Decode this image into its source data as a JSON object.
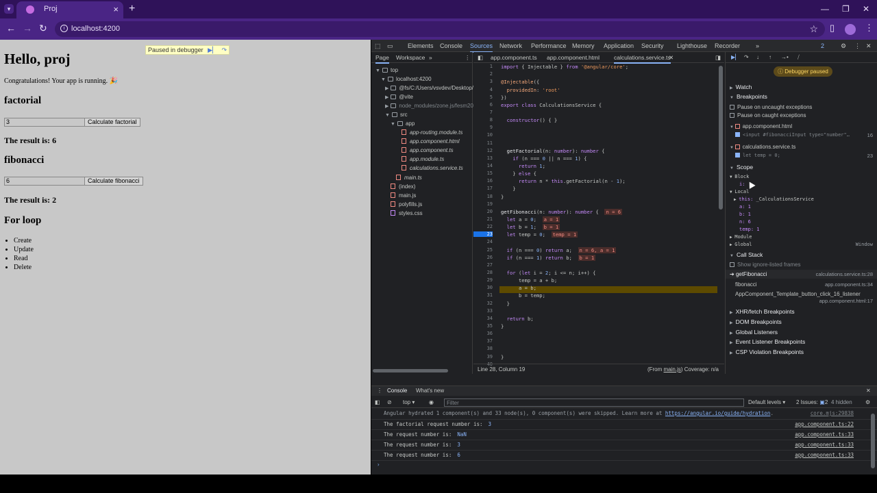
{
  "browser": {
    "tab_title": "Proj",
    "url": "localhost:4200"
  },
  "page": {
    "paused_label": "Paused in debugger",
    "h1": "Hello, proj",
    "congrats": "Congratulations! Your app is running. 🎉",
    "factorial": {
      "heading": "factorial",
      "input_value": "3",
      "button": "Calculate factorial",
      "result": "The result is: 6"
    },
    "fibonacci": {
      "heading": "fibonacci",
      "input_value": "6",
      "button": "Calculate fibonacci",
      "result": "The result is: 2"
    },
    "loop": {
      "heading": "For loop",
      "items": [
        "Create",
        "Update",
        "Read",
        "Delete"
      ]
    }
  },
  "devtools": {
    "tabs": [
      "Elements",
      "Console",
      "Sources",
      "Network",
      "Performance",
      "Memory",
      "Application",
      "Security",
      "Lighthouse",
      "Recorder"
    ],
    "active_tab": "Sources",
    "issues_badge": "2",
    "nav_subtabs": [
      "Page",
      "Workspace"
    ],
    "tree": [
      "top",
      "localhost:4200",
      "@fs/C:/Users/vsvdev/Desktop/",
      "@vite",
      "node_modules/zone.js/fesm20",
      "src",
      "app",
      "app-routing.module.ts",
      "app.component.html",
      "app.component.ts",
      "app.module.ts",
      "calculations.service.ts",
      "main.ts",
      "(index)",
      "main.js",
      "polyfills.js",
      "styles.css"
    ],
    "editor_tabs": [
      "app.component.ts",
      "app.component.html",
      "calculations.service.ts"
    ],
    "status_left": "Line 28, Column 19",
    "status_from": "(From ",
    "status_link": "main.js",
    "status_cov": ") Coverage: n/a",
    "debugger_paused": "Debugger paused",
    "sections": {
      "watch": "Watch",
      "breakpoints": "Breakpoints",
      "pause_uncaught": "Pause on uncaught exceptions",
      "pause_caught": "Pause on caught exceptions",
      "bp_file1": "app.component.html",
      "bp_code1": "<input #fibonacciInput type=\"number\"…",
      "bp_line1": "16",
      "bp_file2": "calculations.service.ts",
      "bp_code2": "let temp = 0;",
      "bp_line2": "23",
      "scope": "Scope",
      "block": "Block",
      "block_i": "i:",
      "local": "Local",
      "this_label": "this:",
      "this_val": "_CalculationsService",
      "local_vars": [
        "a: 1",
        "b: 1",
        "n: 6",
        "temp: 1"
      ],
      "module": "Module",
      "global": "Global",
      "global_val": "Window",
      "call_stack": "Call Stack",
      "show_ignore": "Show ignore-listed frames",
      "frames": [
        {
          "name": "getFibonacci",
          "loc": "calculations.service.ts:28"
        },
        {
          "name": "fibonacci",
          "loc": "app.component.ts:34"
        },
        {
          "name": "AppComponent_Template_button_click_16_listener",
          "loc": "app.component.html:17"
        }
      ],
      "xhr": "XHR/fetch Breakpoints",
      "dom": "DOM Breakpoints",
      "global_listeners": "Global Listeners",
      "event_listener": "Event Listener Breakpoints",
      "csp": "CSP Violation Breakpoints"
    },
    "drawer_tabs": [
      "Console",
      "What's new"
    ],
    "console_context": "top",
    "filter_placeholder": "Filter",
    "default_levels": "Default levels ▾",
    "issues_text": "2 Issues:",
    "issues_count": "2",
    "hidden": "4 hidden",
    "console_lines": [
      {
        "text": "Angular hydrated 1 component(s) and 33 node(s), 0 component(s) were skipped. Learn more at ",
        "link": "https://angular.io/guide/hydration",
        "val": "",
        "src": "core.mjs:29838"
      },
      {
        "text": "The factorial request number is:",
        "link": "",
        "val": "3",
        "src": "app.component.ts:22"
      },
      {
        "text": "The request number is:",
        "link": "",
        "val": "NaN",
        "src": "app.component.ts:33"
      },
      {
        "text": "The request number is:",
        "link": "",
        "val": "3",
        "src": "app.component.ts:33"
      },
      {
        "text": "The request number is:",
        "link": "",
        "val": "6",
        "src": "app.component.ts:33"
      }
    ]
  }
}
